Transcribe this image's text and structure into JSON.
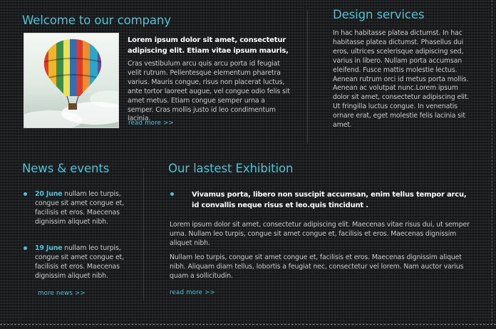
{
  "welcome": {
    "title": "Welcome to our company",
    "lead": "Lorem ipsum dolor sit amet, consectetur adipiscing elit. Etiam vitae ipsum mauris,",
    "body": "Cras vestibulum arcu quis arcu porta id feugiat velit rutrum. Pellentesque elementum pharetra varius. Mauris congue, risus non placerat luctus, ante tortor laoreet augue, vel congue odio felis sit amet metus. Etiam congue semper urna a semper. Cras mollis justo id leo condimentum lacinia.",
    "read_more": "read more >>"
  },
  "design": {
    "title": "Design services",
    "body": "In hac habitasse platea dictumst. In hac habitasse platea dictumst. Phasellus dui eros, ultrices scelerisque adipiscing sed, varius in libero. Nullam porta accumsan eleifend. Fusce mattis molestie lectus. Aenean rutrum orci id metus porta mollis. Aenean ac volutpat nunc.Lorem ipsum dolor sit amet, consectetur adipiscing elit. Ut fringilla luctus congue. In venenatis ornare erat, eget molestie felis lacinia sit amet."
  },
  "news": {
    "title": "News & events",
    "items": [
      {
        "date": "20 June",
        "text": " nullam leo turpis, congue sit amet congue et, facilisis et eros. Maecenas dignissim aliquet nibh."
      },
      {
        "date": "19 June",
        "text": " nullam leo turpis, congue sit amet congue et, facilisis et eros. Maecenas dignissim aliquet nibh."
      }
    ],
    "more": "more news >>"
  },
  "exhibition": {
    "title": "Our lastest Exhibition",
    "lead": "Vivamus porta, libero non suscipit accumsan, enim tellus tempor arcu, id convallis neque risus et leo.quis tincidunt .",
    "para1": "Lorem ipsum dolor sit amet, consectetur adipiscing elit. Maecenas vitae risus dui, ut semper urna. Nullam leo turpis, congue sit amet congue et, facilisis et eros. Maecenas dignissim aliquet nibh.",
    "para2": "Nullam leo turpis, congue sit amet congue et, facilisis et eros. Maecenas dignissim aliquet nibh. Aliquam diam tellus, lobortis a feugiat nec, consectetur vel lorem. Nam auctor varius quam a sollicitudin.",
    "read_more": "read more >>"
  },
  "colors": {
    "accent": "#4fc3d6",
    "background": "#1c1d1f",
    "text": "#c9cacb"
  }
}
